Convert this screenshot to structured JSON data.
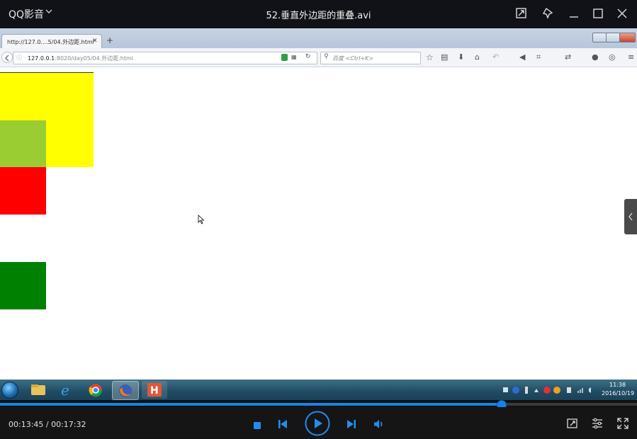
{
  "player": {
    "app_name": "QQ影音",
    "file_title": "52.垂直外边距的重叠.avi",
    "time_current": "00:13:45",
    "time_total": "00:17:32",
    "time_display": "00:13:45 / 00:17:32",
    "progress_fraction": 0.786,
    "accent_color": "#1583e9",
    "icons": [
      "mini-mode-icon",
      "pin-icon",
      "minimize-icon",
      "maximize-icon",
      "close-icon",
      "stop-icon",
      "previous-icon",
      "play-icon",
      "next-icon",
      "volume-icon",
      "screenshot-icon",
      "settings-icon",
      "fullscreen-icon"
    ]
  },
  "browser": {
    "tab_label": "http://127.0....5/04.外边距.html",
    "url_host": "127.0.0.1",
    "url_path": ":8020/day05/04.外边距.html",
    "search_placeholder": "百度 <Ctrl+K>"
  },
  "page": {
    "box_colors": {
      "yellow": "#ffff00",
      "yellowgreen": "#9acd32",
      "red": "#ff0000",
      "green": "#008000"
    }
  },
  "taskbar": {
    "clock_time": "11:38",
    "clock_date": "2016/10/19",
    "apps": [
      "explorer-icon",
      "ie-icon",
      "chrome-icon",
      "firefox-icon",
      "hbuilder-icon"
    ]
  }
}
